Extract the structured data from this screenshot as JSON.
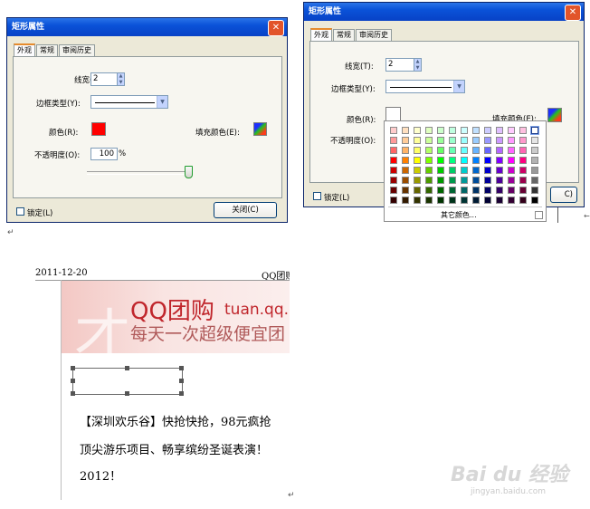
{
  "dialog1": {
    "title": "矩形属性",
    "close": "✕",
    "tabs": [
      "外观",
      "常规",
      "审阅历史"
    ],
    "line_width_label": "线宽(T):",
    "line_width_value": "2",
    "border_type_label": "边框类型(Y):",
    "color_label": "颜色(R):",
    "color_value": "#ff0000",
    "fill_color_label": "填充颜色(E):",
    "opacity_label": "不透明度(O):",
    "opacity_value": "100",
    "opacity_unit": "%",
    "opacity_fraction": 1.0,
    "lock_label": "锁定(L)",
    "close_button": "关闭(C)"
  },
  "dialog2": {
    "title": "矩形属性",
    "close": "✕",
    "tabs": [
      "外观",
      "常规",
      "审阅历史"
    ],
    "line_width_label": "线宽(T):",
    "line_width_value": "2",
    "border_type_label": "边框类型(Y):",
    "color_label": "颜色(R):",
    "color_value": "#ffffff",
    "fill_color_label": "填充颜色(E):",
    "opacity_label": "不透明度(O):",
    "lock_label": "锁定(L)",
    "close_button_partial": "C)",
    "more_colors": "其它颜色..."
  },
  "palette_colors": [
    [
      "#ffcccc",
      "#ffe0c0",
      "#ffffcc",
      "#e0ffc0",
      "#ccffcc",
      "#c0ffe0",
      "#ccffff",
      "#c0e0ff",
      "#ccccff",
      "#e0c0ff",
      "#ffccff",
      "#ffc0e0",
      "#ffffff"
    ],
    [
      "#ff9999",
      "#ffcc99",
      "#ffff99",
      "#ccff99",
      "#99ff99",
      "#99ffcc",
      "#99ffff",
      "#99ccff",
      "#9999ff",
      "#cc99ff",
      "#ff99ff",
      "#ff99cc",
      "#e6e6e6"
    ],
    [
      "#ff6666",
      "#ffb366",
      "#ffff66",
      "#b3ff66",
      "#66ff66",
      "#66ffb3",
      "#66ffff",
      "#66b3ff",
      "#6666ff",
      "#b366ff",
      "#ff66ff",
      "#ff66b3",
      "#cccccc"
    ],
    [
      "#ff0000",
      "#ff8000",
      "#ffff00",
      "#80ff00",
      "#00ff00",
      "#00ff80",
      "#00ffff",
      "#0080ff",
      "#0000ff",
      "#8000ff",
      "#ff00ff",
      "#ff0080",
      "#b3b3b3"
    ],
    [
      "#cc0000",
      "#cc6600",
      "#cccc00",
      "#66cc00",
      "#00cc00",
      "#00cc66",
      "#00cccc",
      "#0066cc",
      "#0000cc",
      "#6600cc",
      "#cc00cc",
      "#cc0066",
      "#999999"
    ],
    [
      "#990000",
      "#994c00",
      "#999900",
      "#4c9900",
      "#009900",
      "#00994c",
      "#009999",
      "#004c99",
      "#000099",
      "#4c0099",
      "#990099",
      "#99004c",
      "#666666"
    ],
    [
      "#660000",
      "#663300",
      "#666600",
      "#336600",
      "#006600",
      "#006633",
      "#006666",
      "#003366",
      "#000066",
      "#330066",
      "#660066",
      "#660033",
      "#333333"
    ],
    [
      "#330000",
      "#331a00",
      "#333300",
      "#1a3300",
      "#003300",
      "#00331a",
      "#003333",
      "#001a33",
      "#000033",
      "#1a0033",
      "#330033",
      "#33001a",
      "#000000"
    ]
  ],
  "document": {
    "date": "2011-12-20",
    "header_right": "QQ团购",
    "banner_title": "QQ团购",
    "banner_domain": "tuan.qq.c",
    "banner_slogan": "每天一次超级便宜团",
    "banner_watermark": "才",
    "para_line1": "【深圳欢乐谷】快抢快抢，98元疯抢",
    "para_line2": "顶尖游乐项目、畅享缤纷圣诞表演！",
    "para_line3": "2012！"
  },
  "watermark": {
    "brand": "Bai du 经验",
    "url": "jingyan.baidu.com"
  },
  "marks": {
    "return": "↵",
    "arrow": "←"
  }
}
